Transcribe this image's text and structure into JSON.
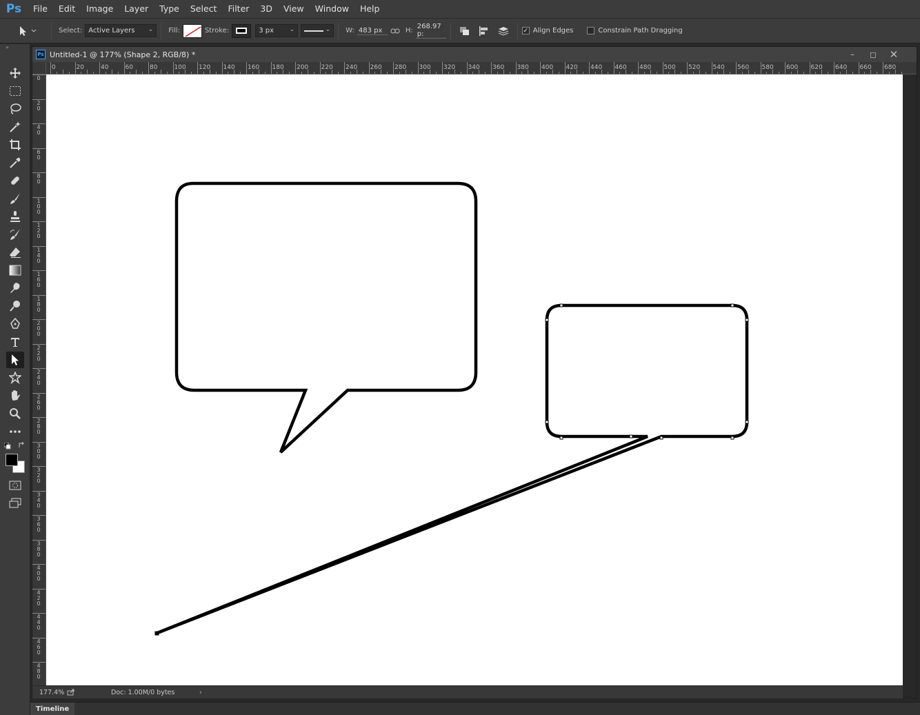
{
  "app": {
    "logo": "Ps"
  },
  "menu": [
    "File",
    "Edit",
    "Image",
    "Layer",
    "Type",
    "Select",
    "Filter",
    "3D",
    "View",
    "Window",
    "Help"
  ],
  "options": {
    "select_label": "Select:",
    "select_value": "Active Layers",
    "fill_label": "Fill:",
    "stroke_label": "Stroke:",
    "stroke_width": "3 px",
    "w_label": "W:",
    "w_value": "483 px",
    "h_label": "H:",
    "h_value": "268.97 p:",
    "align_edges_label": "Align Edges",
    "align_edges_checked": true,
    "constrain_label": "Constrain Path Dragging",
    "constrain_checked": false
  },
  "document": {
    "title": "Untitled-1 @ 177% (Shape 2, RGB/8) *",
    "ps_badge": "Ps",
    "ruler_h": [
      "0",
      "20",
      "40",
      "60",
      "80",
      "100",
      "120",
      "140",
      "160",
      "180",
      "200",
      "220",
      "240",
      "260",
      "280",
      "300",
      "320",
      "340",
      "360",
      "380",
      "400",
      "420",
      "440",
      "460",
      "480",
      "500",
      "520",
      "540",
      "560",
      "580",
      "600",
      "620",
      "640",
      "660",
      "680"
    ],
    "ruler_v": [
      "0",
      "20",
      "40",
      "60",
      "80",
      "100",
      "120",
      "140",
      "160",
      "180",
      "200",
      "220",
      "240",
      "260",
      "280",
      "300",
      "320",
      "340",
      "360",
      "380",
      "400",
      "420",
      "440",
      "460",
      "480"
    ]
  },
  "status": {
    "zoom": "177.4%",
    "doc": "Doc: 1.00M/0 bytes"
  },
  "panels": {
    "timeline": "Timeline"
  }
}
